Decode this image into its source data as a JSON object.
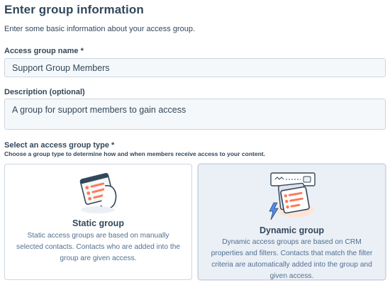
{
  "header": {
    "title": "Enter group information",
    "subtitle": "Enter some basic information about your access group."
  },
  "form": {
    "name_label": "Access group name *",
    "name_value": "Support Group Members",
    "description_label": "Description (optional)",
    "description_value": "A group for support members to gain access",
    "type_label": "Select an access group type *",
    "type_hint": "Choose a group type to determine how and when members receive access to your content."
  },
  "group_types": [
    {
      "title": "Static group",
      "description": "Static access groups are based on manually selected contacts. Contacts who are added into the group are given access.",
      "icon": "static-group-illustration",
      "selected": false
    },
    {
      "title": "Dynamic group",
      "description": "Dynamic access groups are based on CRM properties and filters. Contacts that match the filter criteria are automatically added into the group and given access.",
      "icon": "dynamic-group-illustration",
      "selected": true
    }
  ],
  "colors": {
    "text": "#33475b",
    "border": "#cbd6e2",
    "selected_bg": "#eaf0f6",
    "accent_orange": "#ff7a59",
    "accent_blue": "#516f90"
  }
}
